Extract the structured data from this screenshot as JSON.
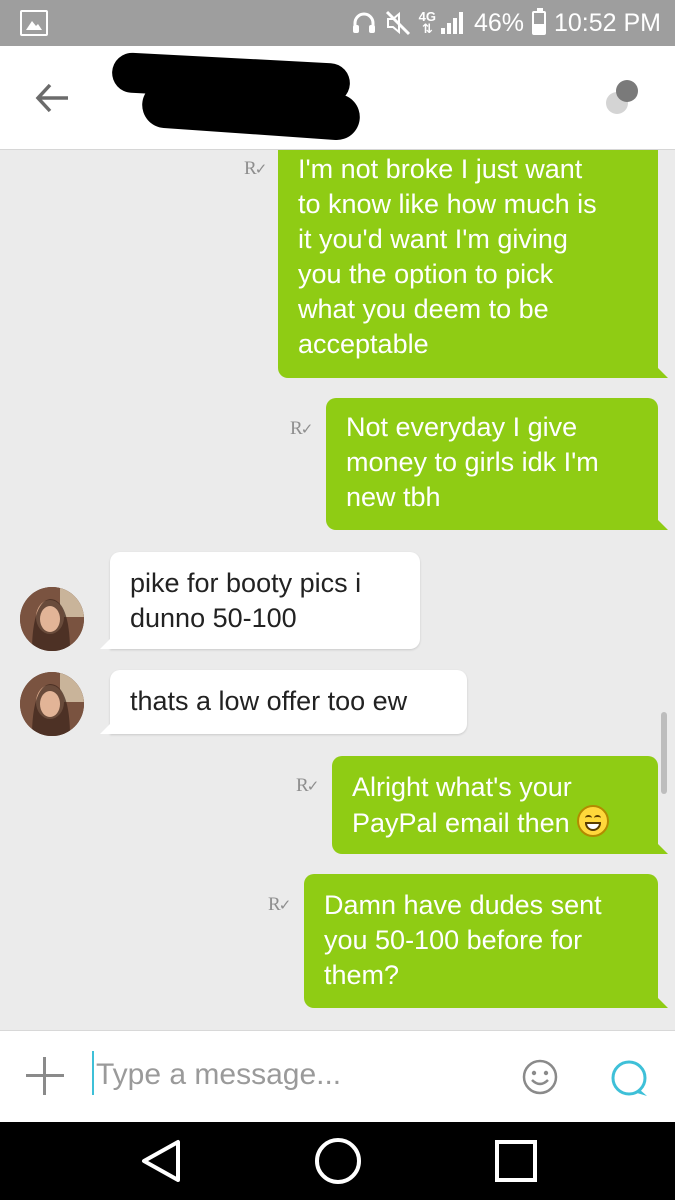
{
  "status_bar": {
    "network": "4G",
    "network_sub": "LTE",
    "battery_percent": "46%",
    "battery_level": 0.46,
    "time": "10:52 PM",
    "icons": [
      "gallery-icon",
      "headset-icon",
      "mute-icon",
      "signal-icon",
      "battery-icon"
    ]
  },
  "header": {
    "icons": [
      "back-arrow-icon",
      "more-options-icon"
    ]
  },
  "messages": [
    {
      "direction": "outgoing",
      "text": "I'm not broke I just want to know like how much is it you'd want I'm giving you the option to pick what you deem to be acceptable",
      "lines": [
        "I'm not broke I just want",
        "to know like how much is",
        "it you'd want I'm giving",
        "you the option to pick",
        "what you deem to be",
        "acceptable"
      ],
      "receipt": "R"
    },
    {
      "direction": "outgoing",
      "text": "Not everyday I give money to girls idk I'm new tbh",
      "lines": [
        "Not everyday I give",
        "money to girls idk I'm",
        "new tbh"
      ],
      "receipt": "R"
    },
    {
      "direction": "incoming",
      "text": "pike for booty pics i dunno 50-100",
      "lines": [
        "pike for booty pics i",
        "dunno 50-100"
      ]
    },
    {
      "direction": "incoming",
      "text": "thats a low offer too ew",
      "lines": [
        "thats a low offer too ew"
      ]
    },
    {
      "direction": "outgoing",
      "text": "Alright what's your PayPal email then",
      "lines": [
        "Alright what's your",
        "PayPal email then"
      ],
      "emoji": "grinning-face",
      "receipt": "R"
    },
    {
      "direction": "outgoing",
      "text": "Damn have dudes sent you 50-100 before for them?",
      "lines": [
        "Damn have dudes sent",
        "you 50-100 before for",
        "them?"
      ],
      "receipt": "R"
    }
  ],
  "input_bar": {
    "placeholder": "Type a message...",
    "value": "",
    "icons": [
      "plus-icon",
      "smiley-icon",
      "chat-bubble-icon"
    ]
  },
  "nav_bar": {
    "icons": [
      "nav-back-icon",
      "nav-home-icon",
      "nav-recents-icon"
    ]
  },
  "colors": {
    "outgoing_bubble": "#8fcc14",
    "incoming_bubble": "#ffffff",
    "chat_background": "#ebebeb",
    "status_bar": "#9e9e9e",
    "accent": "#3ec0d8"
  }
}
